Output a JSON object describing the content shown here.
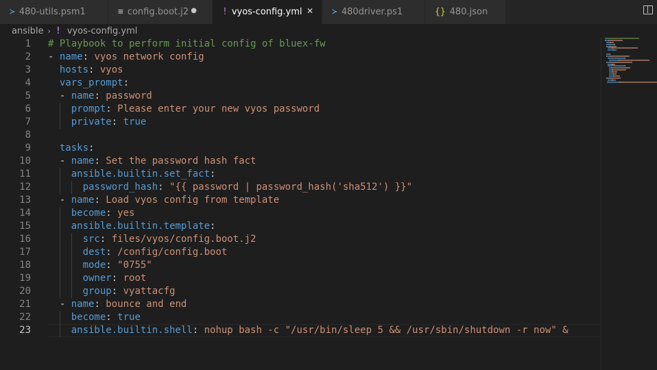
{
  "tabs": [
    {
      "label": "480-utils.psm1",
      "icon": "powershell-icon",
      "glyph": "≻",
      "color": "#4aa3df",
      "active": false,
      "modified": false
    },
    {
      "label": "config.boot.j2",
      "icon": "file-lines-icon",
      "glyph": "≡",
      "color": "#c5c5c5",
      "active": false,
      "modified": true
    },
    {
      "label": "vyos-config.yml",
      "icon": "yaml-icon",
      "glyph": "!",
      "color": "#b180d7",
      "active": true,
      "modified": false
    },
    {
      "label": "480driver.ps1",
      "icon": "powershell-icon",
      "glyph": "≻",
      "color": "#4aa3df",
      "active": false,
      "modified": false
    },
    {
      "label": "480.json",
      "icon": "json-icon",
      "glyph": "{}",
      "color": "#cbcb41",
      "active": false,
      "modified": false
    }
  ],
  "breadcrumb": {
    "folder": "ansible",
    "file": "vyos-config.yml",
    "separator": "›"
  },
  "editor": {
    "current_line": 23,
    "lines": [
      [
        {
          "t": "# Playbook to perform initial config of bluex-fw",
          "c": "c"
        }
      ],
      [
        {
          "t": "- ",
          "c": "p"
        },
        {
          "t": "name",
          "c": "k"
        },
        {
          "t": ": ",
          "c": "p"
        },
        {
          "t": "vyos network config",
          "c": "s"
        }
      ],
      [
        {
          "t": "  ",
          "c": "p"
        },
        {
          "t": "hosts",
          "c": "k"
        },
        {
          "t": ": ",
          "c": "p"
        },
        {
          "t": "vyos",
          "c": "s"
        }
      ],
      [
        {
          "t": "  ",
          "c": "p"
        },
        {
          "t": "vars_prompt",
          "c": "k"
        },
        {
          "t": ":",
          "c": "p"
        }
      ],
      [
        {
          "t": "  - ",
          "c": "p"
        },
        {
          "t": "name",
          "c": "k"
        },
        {
          "t": ": ",
          "c": "p"
        },
        {
          "t": "password",
          "c": "s"
        }
      ],
      [
        {
          "t": "    ",
          "c": "p"
        },
        {
          "t": "prompt",
          "c": "k"
        },
        {
          "t": ": ",
          "c": "p"
        },
        {
          "t": "Please enter your new vyos password",
          "c": "s"
        }
      ],
      [
        {
          "t": "    ",
          "c": "p"
        },
        {
          "t": "private",
          "c": "k"
        },
        {
          "t": ": ",
          "c": "p"
        },
        {
          "t": "true",
          "c": "k"
        }
      ],
      [],
      [
        {
          "t": "  ",
          "c": "p"
        },
        {
          "t": "tasks",
          "c": "k"
        },
        {
          "t": ":",
          "c": "p"
        }
      ],
      [
        {
          "t": "  - ",
          "c": "p"
        },
        {
          "t": "name",
          "c": "k"
        },
        {
          "t": ": ",
          "c": "p"
        },
        {
          "t": "Set the password hash fact",
          "c": "s"
        }
      ],
      [
        {
          "t": "    ",
          "c": "p"
        },
        {
          "t": "ansible.builtin.set_fact",
          "c": "k"
        },
        {
          "t": ":",
          "c": "p"
        }
      ],
      [
        {
          "t": "      ",
          "c": "p"
        },
        {
          "t": "password_hash",
          "c": "k"
        },
        {
          "t": ": ",
          "c": "p"
        },
        {
          "t": "\"{{ password | password_hash('sha512') }}\"",
          "c": "s"
        }
      ],
      [
        {
          "t": "  - ",
          "c": "p"
        },
        {
          "t": "name",
          "c": "k"
        },
        {
          "t": ": ",
          "c": "p"
        },
        {
          "t": "Load vyos config from template",
          "c": "s"
        }
      ],
      [
        {
          "t": "    ",
          "c": "p"
        },
        {
          "t": "become",
          "c": "k"
        },
        {
          "t": ": ",
          "c": "p"
        },
        {
          "t": "yes",
          "c": "s"
        }
      ],
      [
        {
          "t": "    ",
          "c": "p"
        },
        {
          "t": "ansible.builtin.template",
          "c": "k"
        },
        {
          "t": ":",
          "c": "p"
        }
      ],
      [
        {
          "t": "      ",
          "c": "p"
        },
        {
          "t": "src",
          "c": "k"
        },
        {
          "t": ": ",
          "c": "p"
        },
        {
          "t": "files/vyos/config.boot.j2",
          "c": "s"
        }
      ],
      [
        {
          "t": "      ",
          "c": "p"
        },
        {
          "t": "dest",
          "c": "k"
        },
        {
          "t": ": ",
          "c": "p"
        },
        {
          "t": "/config/config.boot",
          "c": "s"
        }
      ],
      [
        {
          "t": "      ",
          "c": "p"
        },
        {
          "t": "mode",
          "c": "k"
        },
        {
          "t": ": ",
          "c": "p"
        },
        {
          "t": "\"0755\"",
          "c": "s"
        }
      ],
      [
        {
          "t": "      ",
          "c": "p"
        },
        {
          "t": "owner",
          "c": "k"
        },
        {
          "t": ": ",
          "c": "p"
        },
        {
          "t": "root",
          "c": "s"
        }
      ],
      [
        {
          "t": "      ",
          "c": "p"
        },
        {
          "t": "group",
          "c": "k"
        },
        {
          "t": ": ",
          "c": "p"
        },
        {
          "t": "vyattacfg",
          "c": "s"
        }
      ],
      [
        {
          "t": "  - ",
          "c": "p"
        },
        {
          "t": "name",
          "c": "k"
        },
        {
          "t": ": ",
          "c": "p"
        },
        {
          "t": "bounce and end",
          "c": "s"
        }
      ],
      [
        {
          "t": "    ",
          "c": "p"
        },
        {
          "t": "become",
          "c": "k"
        },
        {
          "t": ": ",
          "c": "p"
        },
        {
          "t": "true",
          "c": "k"
        }
      ],
      [
        {
          "t": "    ",
          "c": "p"
        },
        {
          "t": "ansible.builtin.shell",
          "c": "k"
        },
        {
          "t": ": ",
          "c": "p"
        },
        {
          "t": "nohup bash -c \"/usr/bin/sleep 5 && /usr/sbin/shutdown -r now\" &",
          "c": "s"
        }
      ]
    ]
  },
  "colors": {
    "comment": "#6a9955",
    "key": "#569cd6",
    "string": "#ce9178",
    "punctuation": "#d4d4d4",
    "background": "#1e1e1e"
  }
}
